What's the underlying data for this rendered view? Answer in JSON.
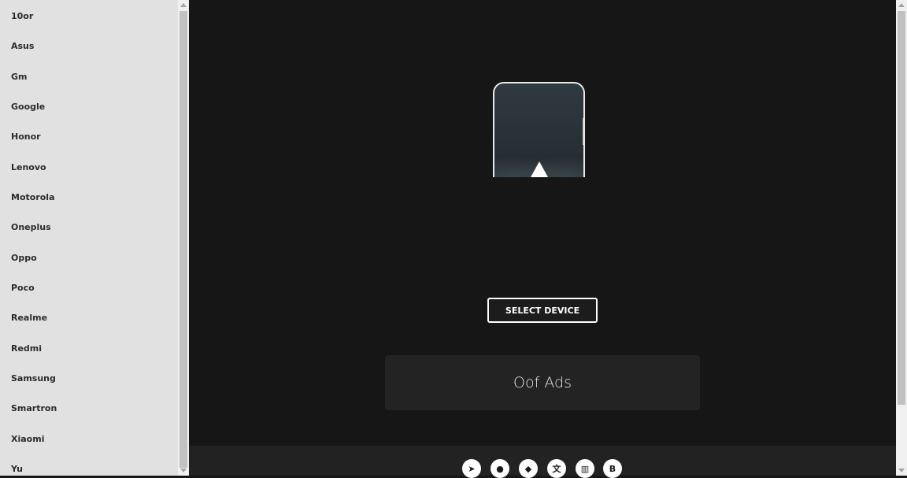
{
  "sidebar": {
    "brands": [
      "10or",
      "Asus",
      "Gm",
      "Google",
      "Honor",
      "Lenovo",
      "Motorola",
      "Oneplus",
      "Oppo",
      "Poco",
      "Realme",
      "Redmi",
      "Samsung",
      "Smartron",
      "Xiaomi",
      "Yu"
    ]
  },
  "main": {
    "select_button_label": "SELECT DEVICE",
    "ads_text": "Oof Ads"
  },
  "footer": {
    "icons": [
      {
        "name": "telegram-icon",
        "glyph": "➤"
      },
      {
        "name": "github-icon",
        "glyph": "●"
      },
      {
        "name": "git-icon",
        "glyph": "◆"
      },
      {
        "name": "translate-icon",
        "glyph": "文"
      },
      {
        "name": "stats-icon",
        "glyph": "▥"
      },
      {
        "name": "blogger-icon",
        "glyph": "B"
      }
    ]
  },
  "colors": {
    "sidebar_bg": "#e1e1e1",
    "main_bg": "#161616",
    "footer_bg": "#222222",
    "ads_bg": "#232323",
    "accent": "#ffffff"
  }
}
